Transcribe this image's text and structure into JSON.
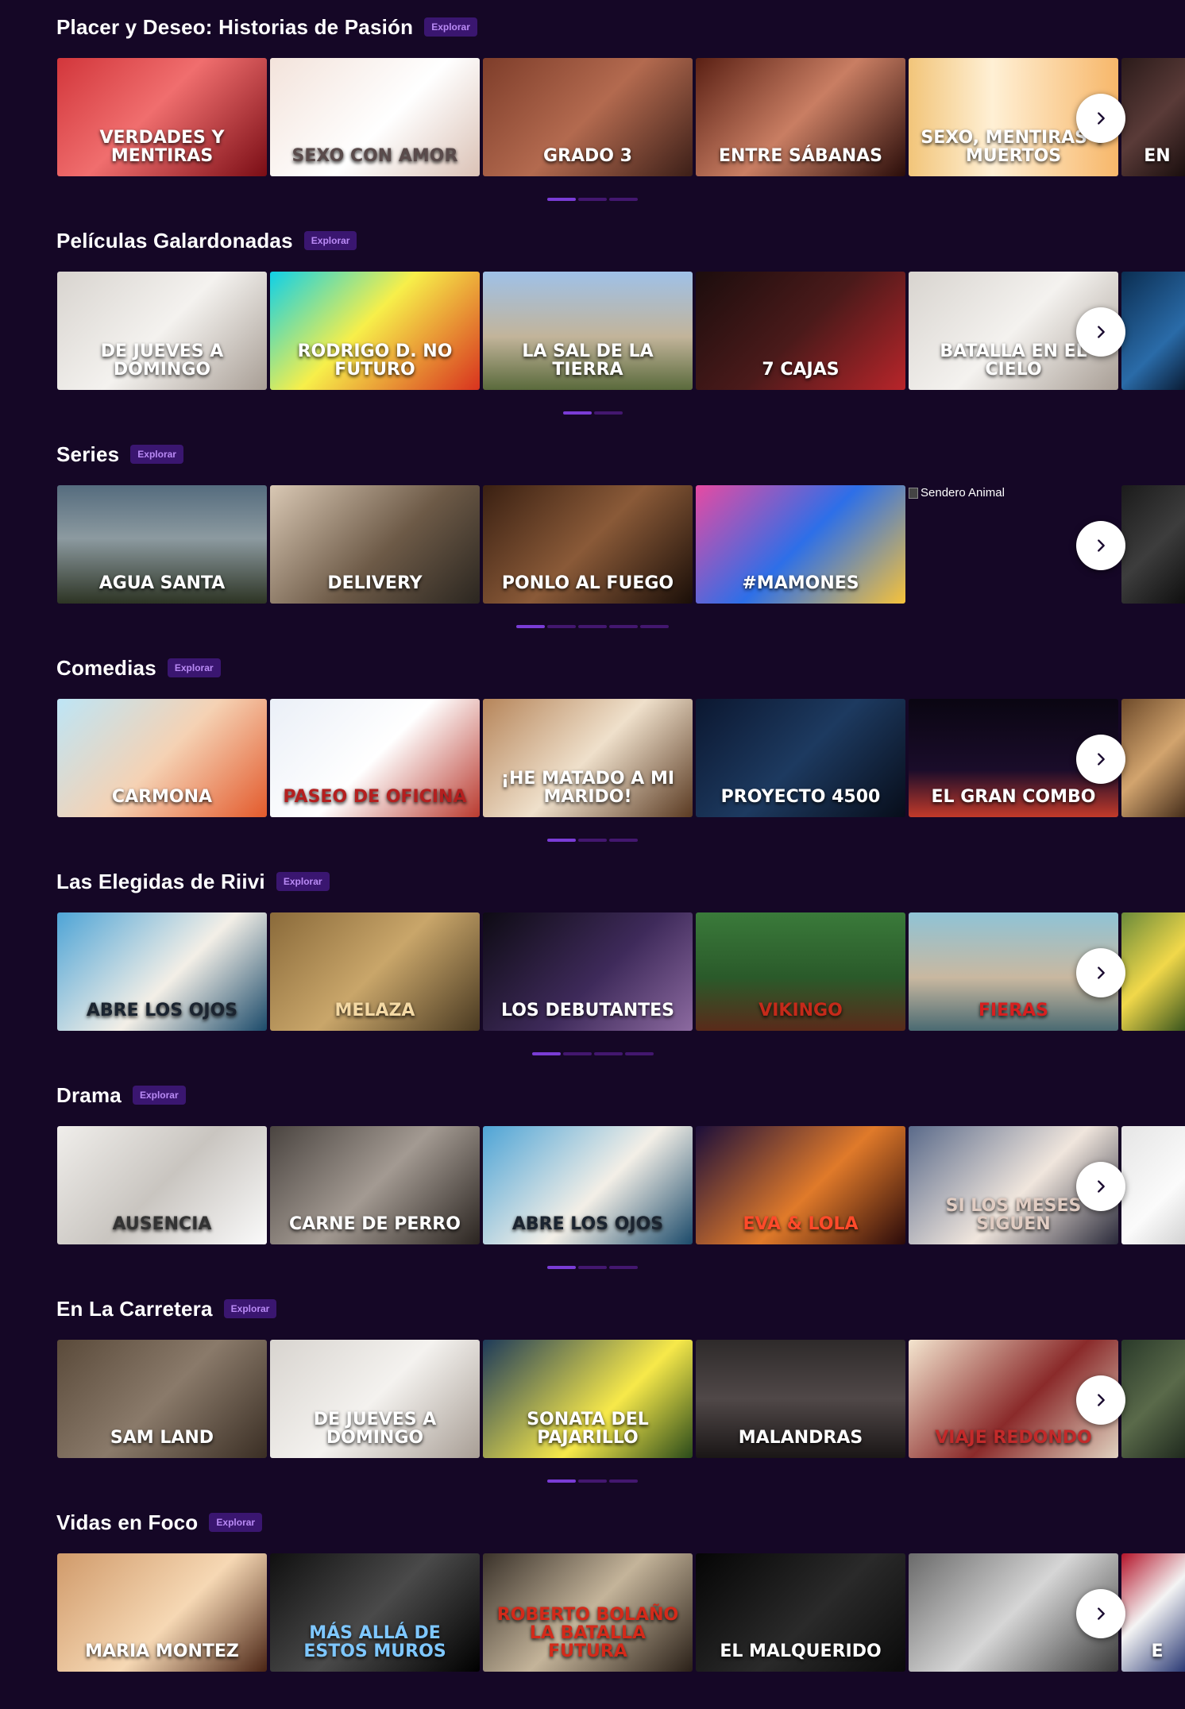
{
  "explore_label": "Explorar",
  "sections": [
    {
      "title": "Placer y Deseo: Historias de Pasión",
      "dots": 3,
      "active_dot": 0,
      "cards": [
        {
          "title": "VERDADES Y MENTIRAS",
          "tint": "tint-red"
        },
        {
          "title": "SEXO con amor",
          "tint": "tint-cream"
        },
        {
          "title": "GRADO 3",
          "tint": "tint-warm"
        },
        {
          "title": "ENTRE SÁBANAS",
          "tint": "tint-skin"
        },
        {
          "title": "SEXO, MENTIRAS Y MUERTOS",
          "tint": "tint-sunset"
        },
        {
          "title": "EN",
          "tint": "tint-dark"
        }
      ]
    },
    {
      "title": "Películas Galardonadas",
      "dots": 2,
      "active_dot": 0,
      "cards": [
        {
          "title": "DE JUEVES A DOMINGO",
          "tint": "tint-linen"
        },
        {
          "title": "RODRIGO D. NO FUTURO",
          "tint": "tint-cyan"
        },
        {
          "title": "LA SAL DE LA TIERRA",
          "tint": "tint-sky"
        },
        {
          "title": "7 CAJAS",
          "tint": "tint-night"
        },
        {
          "title": "BATALLA EN EL CIELO",
          "tint": "tint-linen"
        },
        {
          "title": "",
          "tint": "tint-blue"
        }
      ]
    },
    {
      "title": "Series",
      "dots": 5,
      "active_dot": 0,
      "cards": [
        {
          "title": "AGUA SANTA",
          "tint": "tint-agave"
        },
        {
          "title": "DELIVERY",
          "tint": "tint-street"
        },
        {
          "title": "PONLO AL FUEGO",
          "tint": "tint-kitchen"
        },
        {
          "title": "#MAMONES",
          "tint": "tint-pop"
        },
        {
          "title": "Sendero Animal",
          "tint": "",
          "broken": true
        },
        {
          "title": "",
          "tint": "tint-black"
        }
      ]
    },
    {
      "title": "Comedias",
      "dots": 3,
      "active_dot": 0,
      "cards": [
        {
          "title": "CARMONA",
          "tint": "tint-pastel"
        },
        {
          "title": "PASEO DE OFICINA",
          "tint": "tint-office"
        },
        {
          "title": "¡HE MATADO A MI MARIDO!",
          "tint": "tint-wood"
        },
        {
          "title": "PROYECTO 4500",
          "tint": "tint-navy"
        },
        {
          "title": "EL GRAN COMBO",
          "tint": "tint-space"
        },
        {
          "title": "",
          "tint": "tint-dog"
        }
      ]
    },
    {
      "title": "Las Elegidas de Riivi",
      "dots": 4,
      "active_dot": 0,
      "cards": [
        {
          "title": "ABRE LOS OJOS",
          "tint": "tint-beach"
        },
        {
          "title": "MELAZA",
          "tint": "tint-gold"
        },
        {
          "title": "LOS DEBUTANTES",
          "tint": "tint-violet"
        },
        {
          "title": "VIKINGO",
          "tint": "tint-green"
        },
        {
          "title": "FIERAS",
          "tint": "tint-shore"
        },
        {
          "title": "",
          "tint": "tint-yellow"
        }
      ]
    },
    {
      "title": "Drama",
      "dots": 3,
      "active_dot": 0,
      "cards": [
        {
          "title": "AUSENCIA",
          "tint": "tint-ghost"
        },
        {
          "title": "CARNE DE PERRO",
          "tint": "tint-grey"
        },
        {
          "title": "ABRE LOS OJOS",
          "tint": "tint-beach"
        },
        {
          "title": "Eva & Lola",
          "tint": "tint-flame"
        },
        {
          "title": "SI LOS MESES SIGUEN",
          "tint": "tint-veil"
        },
        {
          "title": "",
          "tint": "tint-pale"
        }
      ]
    },
    {
      "title": "En La Carretera",
      "dots": 3,
      "active_dot": 0,
      "cards": [
        {
          "title": "SAM LAND",
          "tint": "tint-sepia"
        },
        {
          "title": "DE JUEVES A DOMINGO",
          "tint": "tint-linen"
        },
        {
          "title": "SONATA DEL PAJARILLO",
          "tint": "tint-sonata"
        },
        {
          "title": "MALANDRAS",
          "tint": "tint-smoke"
        },
        {
          "title": "VIAJE REDONDO",
          "tint": "tint-mosaic"
        },
        {
          "title": "",
          "tint": "tint-mossy"
        }
      ]
    },
    {
      "title": "Vidas en Foco",
      "dots": 0,
      "active_dot": 0,
      "cards": [
        {
          "title": "MARIA MONTEZ",
          "tint": "tint-rose"
        },
        {
          "title": "más allá de estos muros",
          "tint": "tint-mono"
        },
        {
          "title": "ROBERTO BOLAÑO LA BATALLA FUTURA",
          "tint": "tint-archive"
        },
        {
          "title": "EL MALQUERIDO",
          "tint": "tint-shadow"
        },
        {
          "title": "",
          "tint": "tint-soldier"
        },
        {
          "title": "E",
          "tint": "tint-flag"
        }
      ]
    }
  ]
}
